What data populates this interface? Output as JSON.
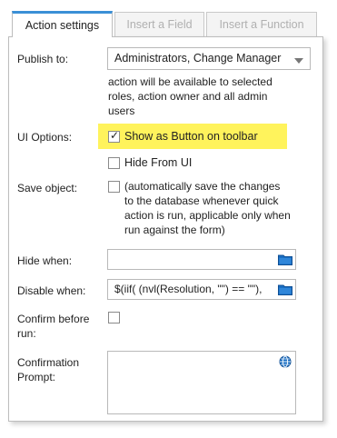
{
  "tabs": [
    {
      "label": "Action settings"
    },
    {
      "label": "Insert a Field"
    },
    {
      "label": "Insert a Function"
    }
  ],
  "publish": {
    "label": "Publish to:",
    "value": "Administrators, Change Manager",
    "help_lines": [
      "action will be available to selected",
      "roles, action owner and all admin",
      "users"
    ]
  },
  "ui_options": {
    "label": "UI Options:",
    "show_button_label": "Show as Button on toolbar",
    "show_button_checked": true,
    "hide_from_ui_label": "Hide From UI",
    "hide_from_ui_checked": false,
    "highlight_color": "#fff35c"
  },
  "save_object": {
    "label": "Save object:",
    "help_lines": [
      "(automatically save the changes",
      "to the database whenever quick",
      "action is run, applicable only when",
      "run against the form)"
    ],
    "checked": false
  },
  "hide_when": {
    "label": "Hide when:",
    "value": ""
  },
  "disable_when": {
    "label": "Disable when:",
    "value": "$(iif( (nvl(Resolution, \"\") == \"\"), "
  },
  "confirm": {
    "label_lines": [
      "Confirm before",
      "run:"
    ],
    "checked": false
  },
  "confirmation_prompt": {
    "label_lines": [
      "Confirmation",
      "Prompt:"
    ],
    "value": ""
  },
  "icons": {
    "folder": "folder-icon",
    "globe": "globe-icon",
    "dropdown": "chevron-down-icon"
  },
  "colors": {
    "accent": "#3a8fd6",
    "folder_blue": "#1a6fc4"
  }
}
